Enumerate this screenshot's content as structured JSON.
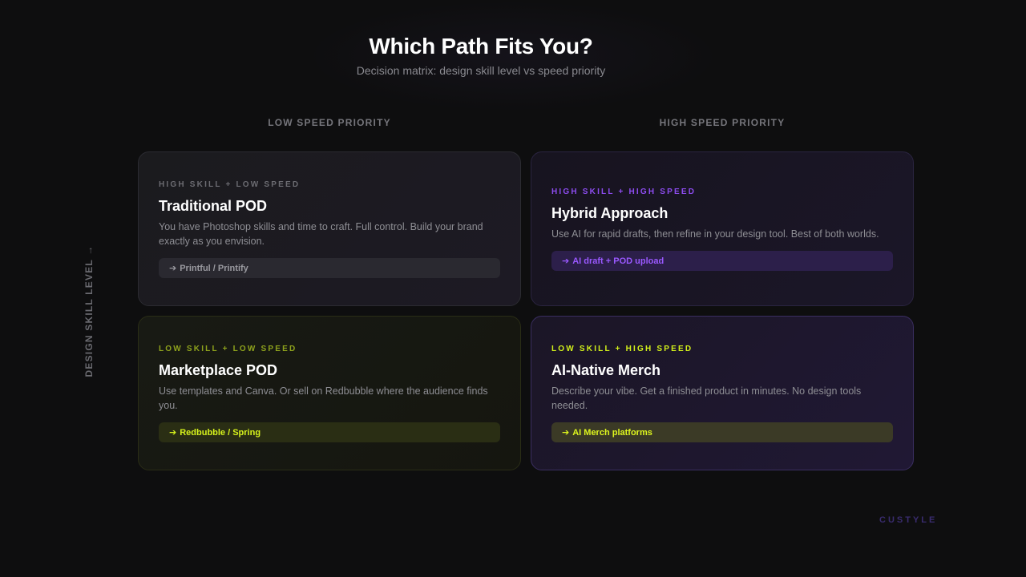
{
  "header": {
    "title": "Which Path Fits You?",
    "subtitle": "Decision matrix: design skill level vs speed priority"
  },
  "columns": {
    "left": "LOW SPEED PRIORITY",
    "right": "HIGH SPEED PRIORITY"
  },
  "y_axis": {
    "label": "DESIGN SKILL LEVEL",
    "arrow": "→"
  },
  "quadrants": [
    {
      "tag": "HIGH SKILL + LOW SPEED",
      "title": "Traditional POD",
      "description": "You have Photoshop skills and time to craft. Full control. Build your brand exactly as you envision.",
      "arrow": "➔",
      "action": "Printful / Printify",
      "accent": "#6c6c72"
    },
    {
      "tag": "HIGH SKILL + HIGH SPEED",
      "title": "Hybrid Approach",
      "description": "Use AI for rapid drafts, then refine in your design tool. Best of both worlds.",
      "arrow": "➔",
      "action": "AI draft + POD upload",
      "accent": "#8d4cf0"
    },
    {
      "tag": "LOW SKILL + LOW SPEED",
      "title": "Marketplace POD",
      "description": "Use templates and Canva. Or sell on Redbubble where the audience finds you.",
      "arrow": "➔",
      "action": "Redbubble / Spring",
      "accent": "#8ea21c"
    },
    {
      "tag": "LOW SKILL + HIGH SPEED",
      "title": "AI-Native Merch",
      "description": "Describe your vibe. Get a finished product in minutes. No design tools needed.",
      "arrow": "➔",
      "action": "AI Merch platforms",
      "accent": "#d2f01a"
    }
  ],
  "brand": "CUSTYLE"
}
